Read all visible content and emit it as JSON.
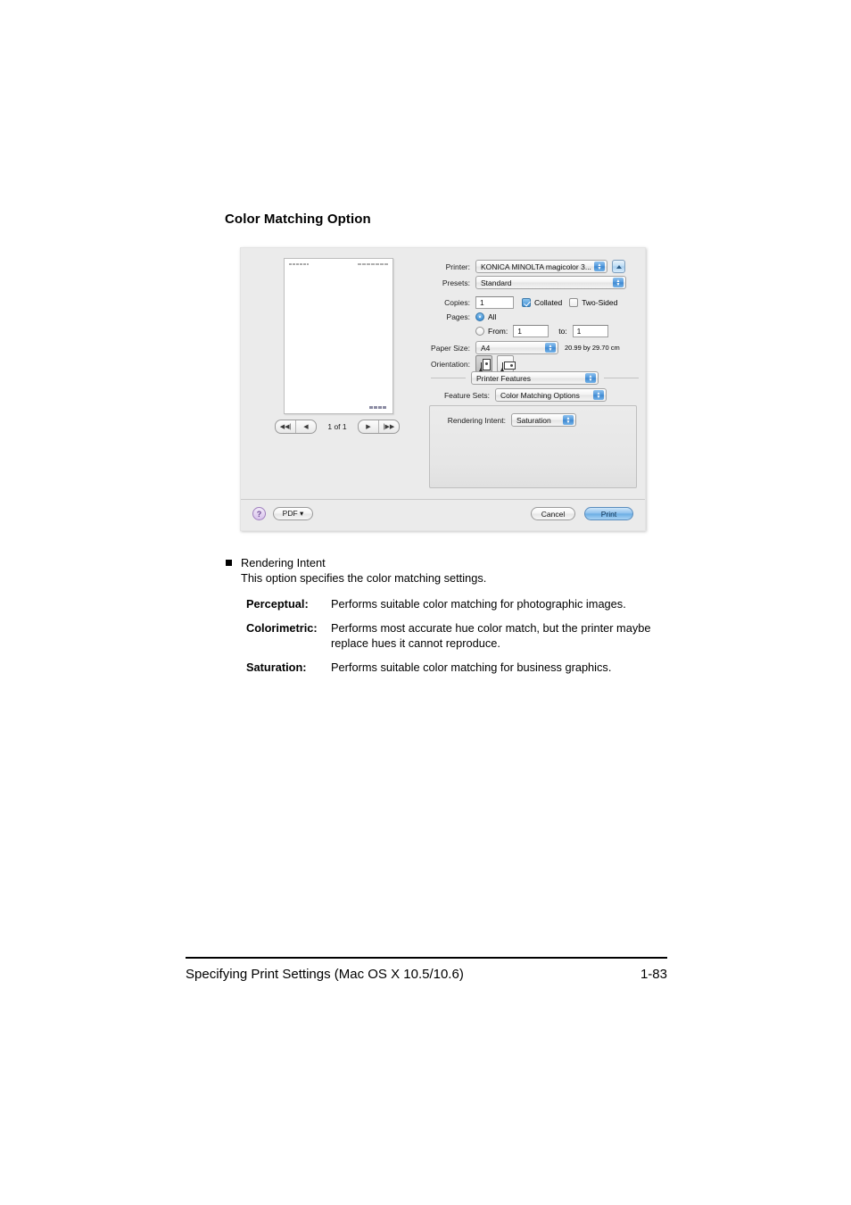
{
  "page": {
    "heading": "Color Matching Option",
    "footer_title": "Specifying Print Settings (Mac OS X 10.5/10.6)",
    "footer_page": "1-83"
  },
  "dialog": {
    "preview": {
      "page_count_label": "1 of 1",
      "nav": {
        "first": "◀◀|",
        "prev": "◀",
        "next": "▶",
        "last": "|▶▶"
      }
    },
    "printer": {
      "label": "Printer:",
      "value": "KONICA MINOLTA magicolor 3..."
    },
    "presets": {
      "label": "Presets:",
      "value": "Standard"
    },
    "copies": {
      "label": "Copies:",
      "value": "1",
      "collated_label": "Collated",
      "collated_checked": true,
      "two_sided_label": "Two-Sided",
      "two_sided_checked": false
    },
    "pages": {
      "label": "Pages:",
      "all_label": "All",
      "all_selected": true,
      "from_label": "From:",
      "from_value": "1",
      "to_label": "to:",
      "to_value": "1"
    },
    "paper_size": {
      "label": "Paper Size:",
      "value": "A4",
      "dimensions": "20.99 by 29.70 cm"
    },
    "orientation": {
      "label": "Orientation:",
      "portrait_selected": true,
      "landscape_selected": false
    },
    "pane_popup": {
      "value": "Printer Features"
    },
    "feature_sets": {
      "label": "Feature Sets:",
      "value": "Color Matching Options"
    },
    "rendering_intent": {
      "label": "Rendering Intent:",
      "value": "Saturation"
    },
    "footer": {
      "help_label": "?",
      "pdf_label": "PDF ▾",
      "cancel_label": "Cancel",
      "print_label": "Print"
    }
  },
  "content": {
    "bullet_title": "Rendering Intent",
    "bullet_desc": "This option specifies the color matching settings.",
    "definitions": [
      {
        "term": "Perceptual",
        "colon": ":",
        "desc": "Performs suitable color matching for photographic images."
      },
      {
        "term": "Colorimetric",
        "colon": ":",
        "desc": "Performs most accurate hue color match, but the printer maybe replace hues it cannot reproduce."
      },
      {
        "term": "Saturation",
        "colon": ":",
        "desc": "Performs suitable color matching for business graphics."
      }
    ]
  },
  "colors": {
    "dialog_bg": "#ebebeb",
    "accent_blue": "#3f8fd4",
    "help_purple": "#d8c2ec",
    "print_button": "#8cc0ec"
  }
}
